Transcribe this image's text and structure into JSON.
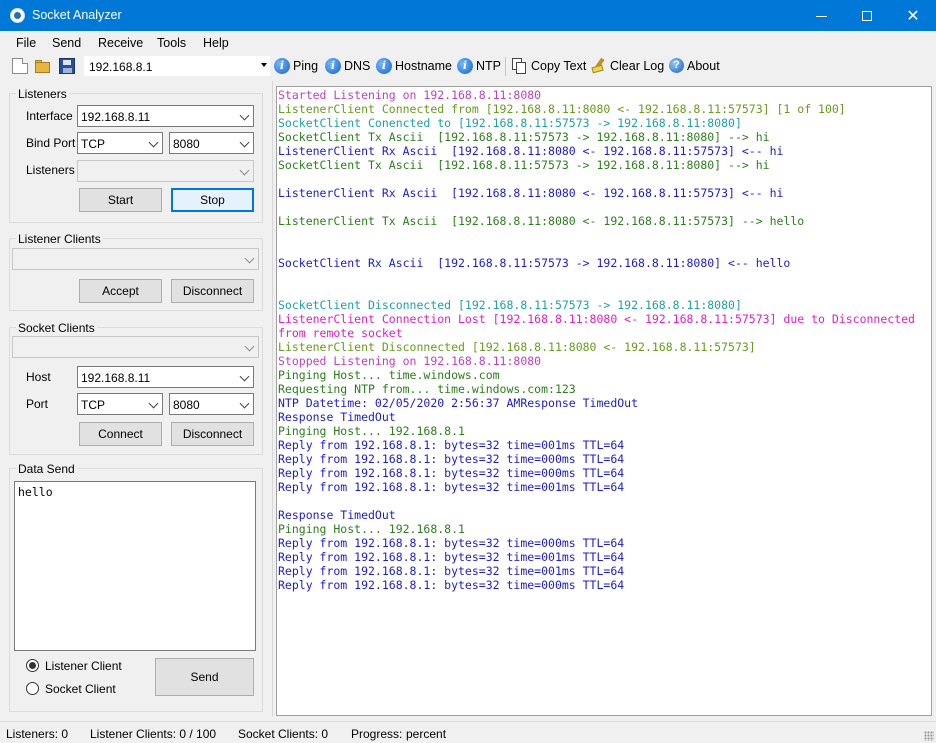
{
  "window": {
    "title": "Socket Analyzer"
  },
  "menu": [
    "File",
    "Send",
    "Receive",
    "Tools",
    "Help"
  ],
  "toolbar": {
    "host_value": "192.168.8.1",
    "ping": "Ping",
    "dns": "DNS",
    "hostname": "Hostname",
    "ntp": "NTP",
    "copy_text": "Copy Text",
    "clear_log": "Clear Log",
    "about": "About"
  },
  "listeners": {
    "title": "Listeners",
    "interface_label": "Interface",
    "interface_value": "192.168.8.11",
    "bind_port_label": "Bind Port",
    "protocol_value": "TCP",
    "port_value": "8080",
    "listeners_label": "Listeners",
    "listeners_value": "",
    "start": "Start",
    "stop": "Stop"
  },
  "listener_clients": {
    "title": "Listener Clients",
    "accept": "Accept",
    "disconnect": "Disconnect"
  },
  "socket_clients": {
    "title": "Socket Clients",
    "host_label": "Host",
    "host_value": "192.168.8.11",
    "port_label": "Port",
    "protocol_value": "TCP",
    "port_value": "8080",
    "connect": "Connect",
    "disconnect": "Disconnect"
  },
  "data_send": {
    "title": "Data Send",
    "text": "hello",
    "radio_listener": "Listener Client",
    "radio_socket": "Socket Client",
    "selected": "Listener Client",
    "send": "Send"
  },
  "colors": {
    "purple": "#c040c0",
    "olive": "#4a8a20",
    "teal": "#20a0a0",
    "green": "#3a7a28",
    "blue": "#1c1ccc",
    "magenta": "#e020c0"
  },
  "log": [
    {
      "text": "Started Listening on 192.168.8.11:8080",
      "color": "#c040c0"
    },
    {
      "text": "ListenerClient Connected from [192.168.8.11:8080 <- 192.168.8.11:57573] [1 of 100]",
      "color": "#6a9a20"
    },
    {
      "text": "SocketClient Conencted to [192.168.8.11:57573 -> 192.168.8.11:8080]",
      "color": "#20a0a0"
    },
    {
      "text": "SocketClient Tx Ascii  [192.168.8.11:57573 -> 192.168.8.11:8080] --> hi",
      "color": "#2e7d1e"
    },
    {
      "text": "ListenerClient Rx Ascii  [192.168.8.11:8080 <- 192.168.8.11:57573] <-- hi",
      "color": "#1c1ccc"
    },
    {
      "text": "SocketClient Tx Ascii  [192.168.8.11:57573 -> 192.168.8.11:8080] --> hi",
      "color": "#2e7d1e"
    },
    {
      "text": "",
      "color": "#000000"
    },
    {
      "text": "ListenerClient Rx Ascii  [192.168.8.11:8080 <- 192.168.8.11:57573] <-- hi",
      "color": "#1c1ccc"
    },
    {
      "text": "",
      "color": "#000000"
    },
    {
      "text": "ListenerClient Tx Ascii  [192.168.8.11:8080 <- 192.168.8.11:57573] --> hello",
      "color": "#2e7d1e"
    },
    {
      "text": "",
      "color": "#000000"
    },
    {
      "text": "",
      "color": "#000000"
    },
    {
      "text": "SocketClient Rx Ascii  [192.168.8.11:57573 -> 192.168.8.11:8080] <-- hello",
      "color": "#1c1ccc"
    },
    {
      "text": "",
      "color": "#000000"
    },
    {
      "text": "",
      "color": "#000000"
    },
    {
      "text": "SocketClient Disconnected [192.168.8.11:57573 -> 192.168.8.11:8080]",
      "color": "#20a0a0"
    },
    {
      "text": "ListenerClient Connection Lost [192.168.8.11:8080 <- 192.168.8.11:57573] due to Disconnected",
      "color": "#e020c0"
    },
    {
      "text": "from remote socket",
      "color": "#e020c0"
    },
    {
      "text": "ListenerClient Disconnected [192.168.8.11:8080 <- 192.168.8.11:57573]",
      "color": "#6a9a20"
    },
    {
      "text": "Stopped Listening on 192.168.8.11:8080",
      "color": "#c040c0"
    },
    {
      "text": "Pinging Host... time.windows.com",
      "color": "#2e7d1e"
    },
    {
      "text": "Requesting NTP from... time.windows.com:123",
      "color": "#2e7d1e"
    },
    {
      "text": "NTP Datetime: 02/05/2020 2:56:37 AMResponse TimedOut",
      "color": "#1c1ccc"
    },
    {
      "text": "Response TimedOut",
      "color": "#1c1ccc"
    },
    {
      "text": "Pinging Host... 192.168.8.1",
      "color": "#2e7d1e"
    },
    {
      "text": "Reply from 192.168.8.1: bytes=32 time=001ms TTL=64",
      "color": "#1c1ccc"
    },
    {
      "text": "Reply from 192.168.8.1: bytes=32 time=000ms TTL=64",
      "color": "#1c1ccc"
    },
    {
      "text": "Reply from 192.168.8.1: bytes=32 time=000ms TTL=64",
      "color": "#1c1ccc"
    },
    {
      "text": "Reply from 192.168.8.1: bytes=32 time=001ms TTL=64",
      "color": "#1c1ccc"
    },
    {
      "text": "",
      "color": "#000000"
    },
    {
      "text": "Response TimedOut",
      "color": "#1c1ccc"
    },
    {
      "text": "Pinging Host... 192.168.8.1",
      "color": "#2e7d1e"
    },
    {
      "text": "Reply from 192.168.8.1: bytes=32 time=000ms TTL=64",
      "color": "#1c1ccc"
    },
    {
      "text": "Reply from 192.168.8.1: bytes=32 time=001ms TTL=64",
      "color": "#1c1ccc"
    },
    {
      "text": "Reply from 192.168.8.1: bytes=32 time=001ms TTL=64",
      "color": "#1c1ccc"
    },
    {
      "text": "Reply from 192.168.8.1: bytes=32 time=000ms TTL=64",
      "color": "#1c1ccc"
    }
  ],
  "status": {
    "listeners": "Listeners: 0",
    "listener_clients": "Listener Clients: 0 / 100",
    "socket_clients": "Socket Clients: 0",
    "progress_label": "Progress:",
    "progress_value": "percent"
  }
}
